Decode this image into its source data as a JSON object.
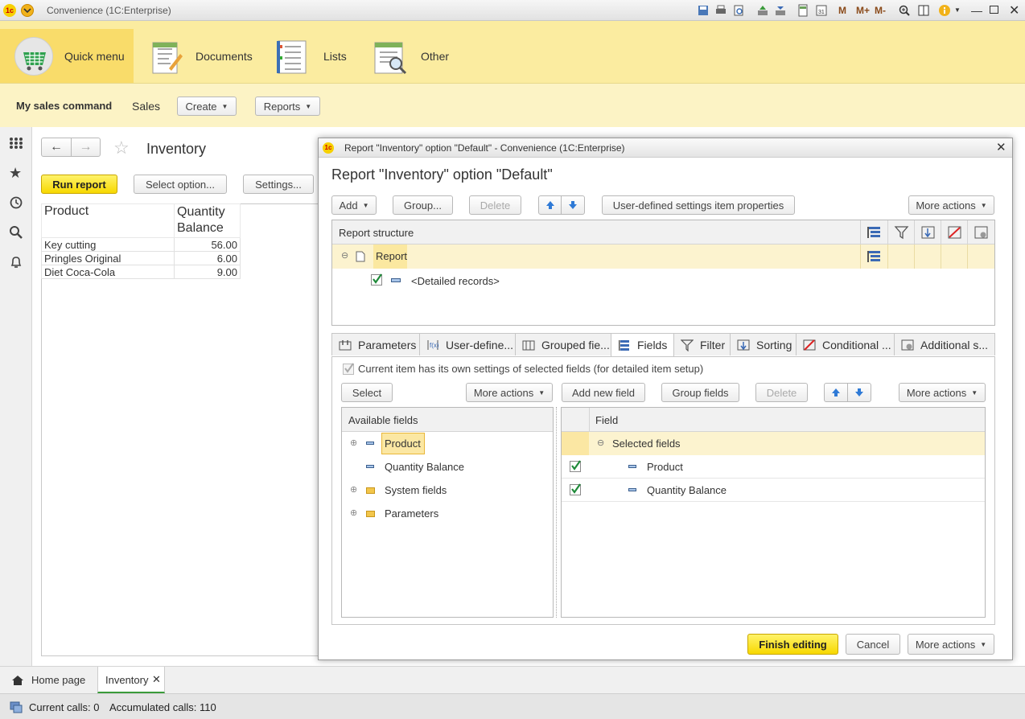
{
  "window": {
    "title": "Convenience  (1C:Enterprise)"
  },
  "sections": [
    {
      "label": "Quick menu"
    },
    {
      "label": "Documents"
    },
    {
      "label": "Lists"
    },
    {
      "label": "Other"
    }
  ],
  "nav": {
    "command_title": "My sales command",
    "sales": "Sales",
    "create": "Create",
    "reports": "Reports"
  },
  "inventory": {
    "title": "Inventory",
    "run_report": "Run report",
    "select_option": "Select option...",
    "settings": "Settings...",
    "headers": [
      "Product",
      "Quantity",
      "Balance"
    ],
    "rows": [
      {
        "product": "Key cutting",
        "qty": "56.00"
      },
      {
        "product": "Pringles Original",
        "qty": "6.00"
      },
      {
        "product": "Diet Coca-Cola",
        "qty": "9.00"
      }
    ]
  },
  "dialog": {
    "window_title": "Report \"Inventory\" option \"Default\" - Convenience  (1C:Enterprise)",
    "heading": "Report \"Inventory\" option \"Default\"",
    "toolbar": {
      "add": "Add",
      "group": "Group...",
      "delete": "Delete",
      "user_props": "User-defined settings item properties",
      "more": "More actions"
    },
    "structure": {
      "header": "Report structure",
      "root": "Report",
      "child": "<Detailed records>"
    },
    "tabs": [
      "Parameters",
      "User-define...",
      "Grouped fie...",
      "Fields",
      "Filter",
      "Sorting",
      "Conditional ...",
      "Additional s..."
    ],
    "own_settings": "Current item has its own settings of selected fields (for detailed item setup)",
    "left_toolbar": {
      "select": "Select",
      "more": "More actions"
    },
    "right_toolbar": {
      "add_field": "Add new field",
      "group_fields": "Group fields",
      "delete": "Delete",
      "more": "More actions"
    },
    "available": {
      "header": "Available fields",
      "items": [
        "Product",
        "Quantity Balance",
        "System fields",
        "Parameters"
      ]
    },
    "selected": {
      "header": "Field",
      "group": "Selected fields",
      "items": [
        "Product",
        "Quantity Balance"
      ]
    },
    "footer": {
      "finish": "Finish editing",
      "cancel": "Cancel",
      "more": "More actions"
    }
  },
  "bottom_tabs": {
    "home": "Home page",
    "inventory": "Inventory"
  },
  "status": {
    "current_calls": "Current calls: 0",
    "accumulated_calls": "Accumulated calls: 110"
  }
}
